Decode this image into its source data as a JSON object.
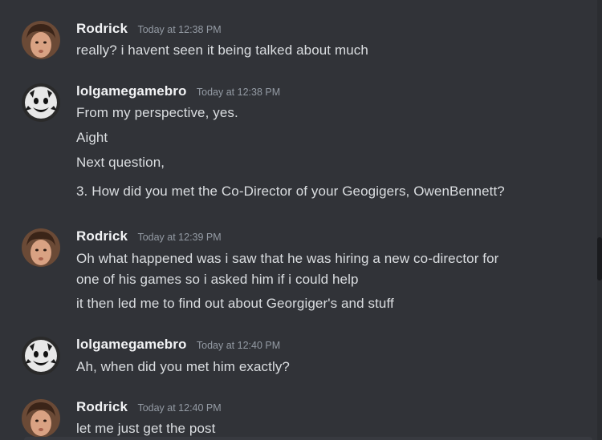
{
  "messages": [
    {
      "user": "Rodrick",
      "avatar": "face-photo-avatar",
      "time": "Today at 12:38 PM",
      "lines": [
        "really? i havent seen it being talked about much"
      ]
    },
    {
      "user": "lolgamegamebro",
      "avatar": "smiley-mask-avatar",
      "time": "Today at 12:38 PM",
      "lines": [
        "From my perspective, yes.",
        "Aight",
        "Next question,",
        "3. How did you met the Co-Director of your Geogigers, OwenBennett?"
      ]
    },
    {
      "user": "Rodrick",
      "avatar": "face-photo-avatar",
      "time": "Today at 12:39 PM",
      "lines": [
        "Oh what happened was i saw that he was hiring a new co-director for",
        "one of his games so i asked him if i could help",
        "it then led me to find out about Georgiger's and stuff"
      ]
    },
    {
      "user": "lolgamegamebro",
      "avatar": "smiley-mask-avatar",
      "time": "Today at 12:40 PM",
      "lines": [
        "Ah, when did you met him exactly?"
      ]
    },
    {
      "user": "Rodrick",
      "avatar": "face-photo-avatar",
      "time": "Today at 12:40 PM",
      "lines": [
        "let me just get the post"
      ]
    }
  ],
  "colors": {
    "background": "#313338",
    "username": "#f2f3f5",
    "timestamp": "#949ba4",
    "message_text": "#dbdee1"
  }
}
